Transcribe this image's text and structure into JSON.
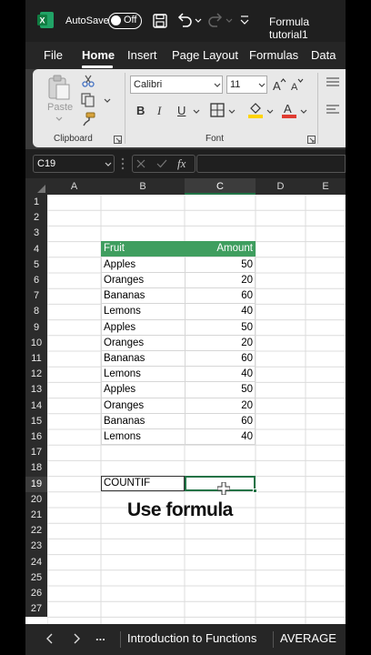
{
  "titlebar": {
    "autosave_label": "AutoSave",
    "toggle_state": "Off",
    "file_title": "Formula tutorial1"
  },
  "menu": {
    "items": [
      "File",
      "Home",
      "Insert",
      "Page Layout",
      "Formulas",
      "Data"
    ],
    "active": "Home"
  },
  "ribbon": {
    "paste_label": "Paste",
    "clipboard_label": "Clipboard",
    "font_label": "Font",
    "font_name": "Calibri",
    "font_size": "11",
    "bold": "B",
    "italic": "I",
    "underline": "U",
    "increase_font": "A^",
    "decrease_font": "A^"
  },
  "formula_bar": {
    "name_box": "C19",
    "fx": "fx",
    "content": ""
  },
  "columns": [
    "A",
    "B",
    "C",
    "D",
    "E"
  ],
  "rows": [
    "1",
    "2",
    "3",
    "4",
    "5",
    "6",
    "7",
    "8",
    "9",
    "10",
    "11",
    "12",
    "13",
    "14",
    "15",
    "16",
    "17",
    "18",
    "19",
    "20",
    "21",
    "22",
    "23",
    "24",
    "25",
    "26",
    "27"
  ],
  "table": {
    "header": {
      "fruit": "Fruit",
      "amount": "Amount"
    },
    "rows": [
      {
        "fruit": "Apples",
        "amount": "50"
      },
      {
        "fruit": "Oranges",
        "amount": "20"
      },
      {
        "fruit": "Bananas",
        "amount": "60"
      },
      {
        "fruit": "Lemons",
        "amount": "40"
      },
      {
        "fruit": "Apples",
        "amount": "50"
      },
      {
        "fruit": "Oranges",
        "amount": "20"
      },
      {
        "fruit": "Bananas",
        "amount": "60"
      },
      {
        "fruit": "Lemons",
        "amount": "40"
      },
      {
        "fruit": "Apples",
        "amount": "50"
      },
      {
        "fruit": "Oranges",
        "amount": "20"
      },
      {
        "fruit": "Bananas",
        "amount": "60"
      },
      {
        "fruit": "Lemons",
        "amount": "40"
      }
    ]
  },
  "countif_label": "COUNTIF",
  "overlay_caption": "Use formula",
  "sheet_tabs": {
    "more": "...",
    "tabs": [
      "Introduction to Functions",
      "AVERAGE"
    ]
  },
  "colors": {
    "header_green": "#3f9e5f",
    "title_bg": "#1f1f1f",
    "ribbon_bg": "#e8e8e8",
    "excel_green": "#1e7145"
  }
}
